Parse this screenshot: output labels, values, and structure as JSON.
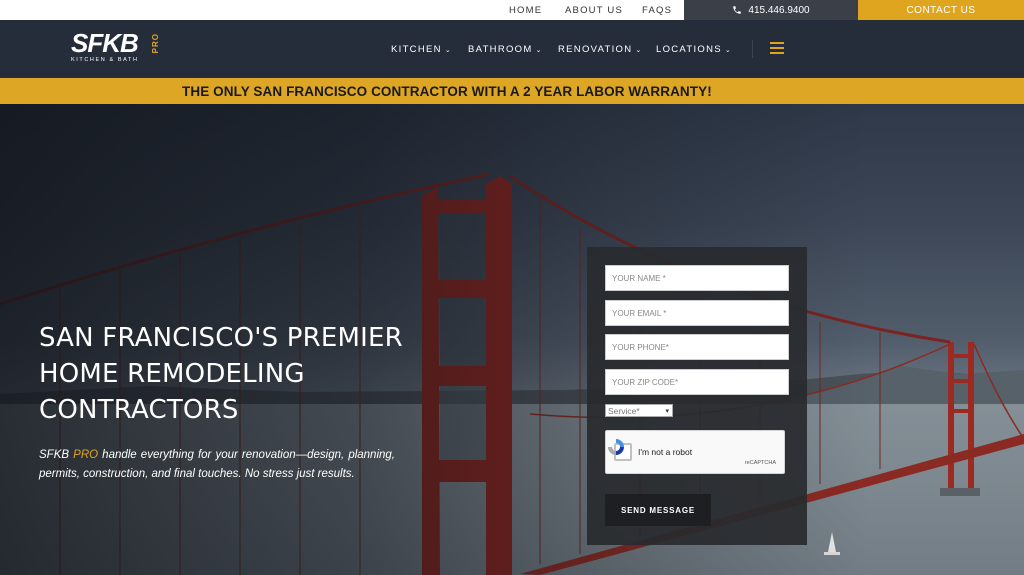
{
  "topbar": {
    "nav": [
      "HOME",
      "ABOUT US",
      "FAQS"
    ],
    "phone": "415.446.9400",
    "contact": "CONTACT US"
  },
  "logo": {
    "main": "SFKB",
    "pro": "PRO",
    "sub": "KITCHEN & BATH"
  },
  "mainnav": [
    "KITCHEN",
    "BATHROOM",
    "RENOVATION",
    "LOCATIONS"
  ],
  "banner": "THE ONLY SAN FRANCISCO CONTRACTOR WITH A 2 YEAR LABOR WARRANTY!",
  "hero": {
    "headline": [
      "SAN FRANCISCO'S PREMIER",
      "HOME REMODELING",
      "CONTRACTORS"
    ],
    "desc_brand": "SFKB",
    "desc_pro": "PRO",
    "desc_rest": " handle everything for your renovation—design, planning, permits, construction, and final touches. No stress just results."
  },
  "form": {
    "name_ph": "YOUR NAME *",
    "email_ph": "YOUR EMAIL *",
    "phone_ph": "YOUR PHONE*",
    "zip_ph": "YOUR ZIP CODE*",
    "service": "Service*",
    "captcha_label": "I'm not a robot",
    "captcha_brand": "reCAPTCHA",
    "send": "SEND MESSAGE"
  },
  "colors": {
    "accent": "#e0a51e",
    "header": "#262d3a",
    "bridge": "#9b2a22"
  }
}
